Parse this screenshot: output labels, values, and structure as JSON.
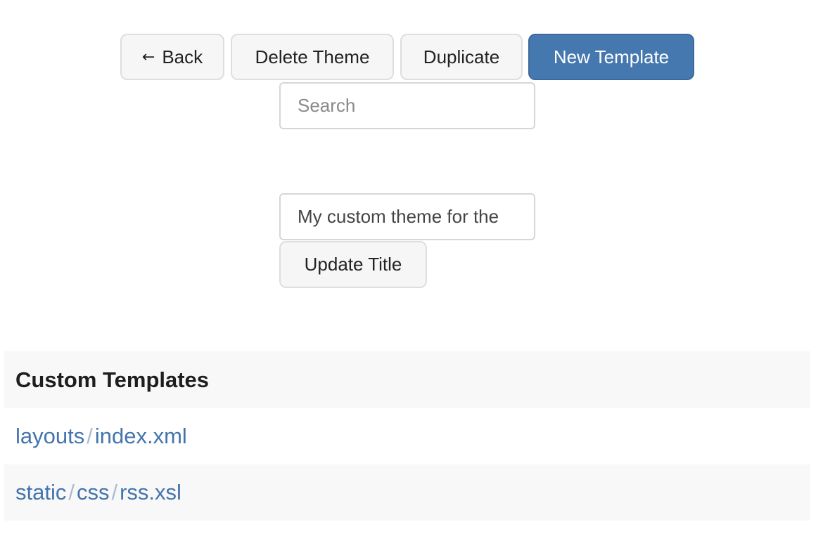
{
  "toolbar": {
    "back_label": "Back",
    "back_icon": "←",
    "delete_label": "Delete Theme",
    "duplicate_label": "Duplicate",
    "new_template_label": "New Template"
  },
  "search": {
    "placeholder": "Search",
    "value": ""
  },
  "title_form": {
    "value": "My custom theme for the",
    "update_label": "Update Title"
  },
  "templates": {
    "heading": "Custom Templates",
    "items": [
      {
        "segments": [
          "layouts",
          "index.xml"
        ]
      },
      {
        "segments": [
          "static",
          "css",
          "rss.xsl"
        ]
      }
    ],
    "separator": "/"
  },
  "colors": {
    "primary": "#4678b0",
    "link": "#4374ad",
    "row_alt": "#f8f8f8"
  }
}
